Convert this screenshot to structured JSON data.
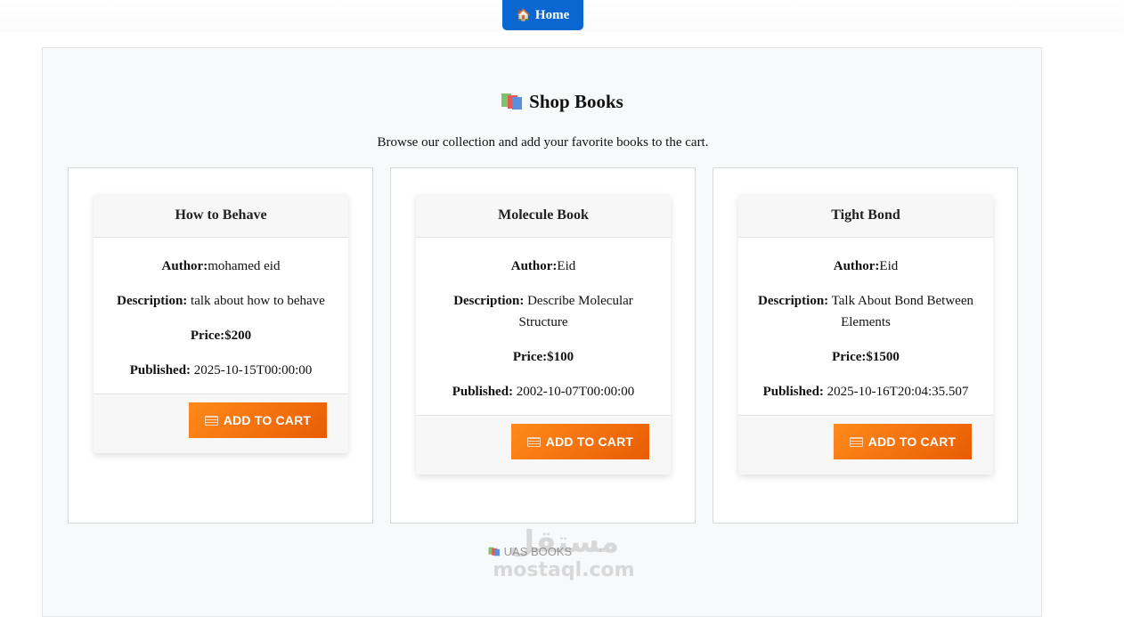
{
  "nav": {
    "home_label": "Home",
    "home_icon": "house-icon"
  },
  "page": {
    "title": "Shop Books",
    "title_icon": "books-icon",
    "subtitle": "Browse our collection and add your favorite books to the cart."
  },
  "labels": {
    "author": "Author:",
    "description": "Description:",
    "published": "Published:",
    "add_to_cart": "ADD TO CART"
  },
  "books": [
    {
      "title": "How to Behave",
      "author": "mohamed eid",
      "description": "talk about how to behave",
      "price": "Price:$200",
      "published": "2025-10-15T00:00:00"
    },
    {
      "title": "Molecule Book",
      "author": "Eid",
      "description": "Describe Molecular Structure",
      "price": "Price:$100",
      "published": "2002-10-07T00:00:00"
    },
    {
      "title": "Tight Bond",
      "author": "Eid",
      "description": "Talk About Bond Between Elements",
      "price": "Price:$1500",
      "published": "2025-10-16T20:04:35.507"
    }
  ],
  "footer": {
    "logo_text": "UAS BOOKS"
  },
  "watermark": {
    "arabic": "مستقل",
    "latin": "mostaql.com"
  },
  "colors": {
    "primary": "#0a66d0",
    "accent": "#f97316"
  }
}
